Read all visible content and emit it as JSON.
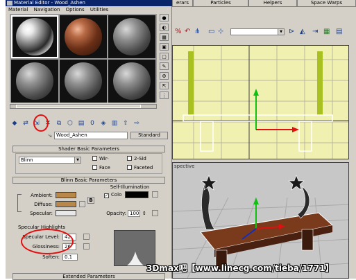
{
  "titlebar": {
    "title": "Material Editor - Wood_Ashen"
  },
  "menu": [
    "Material",
    "Navigation",
    "Options",
    "Utilities"
  ],
  "material_name": "Wood_Ashen",
  "material_type_button": "Standard",
  "shader_panel": {
    "header": "Shader Basic Parameters",
    "shader": "Blinn",
    "wire": "Wir·",
    "two_sided": "2-Sid",
    "face": "Face",
    "faceted": "Faceted"
  },
  "blinn_panel": {
    "header": "Blinn Basic Parameters",
    "self_illum_group": "Self-Illumination",
    "color_label": "Colo",
    "ambient": "Ambient:",
    "diffuse": "Diffuse:",
    "specular": "Specular:",
    "lock_label": "B",
    "opacity_label": "Opacity:",
    "opacity_value": "100",
    "opacity_suffix": "↕",
    "specular_highlights": {
      "group": "Specular Highlights",
      "specular_level_label": "Specular Level:",
      "specular_level_value": "42",
      "glossiness_label": "Glossiness:",
      "glossiness_value": "26",
      "soften_label": "Soften:",
      "soften_value": "0.1"
    }
  },
  "extended_header": "Extended Parameters",
  "viewport": {
    "tabs": [
      "erars",
      "Particles",
      "Helpers",
      "Space Warps"
    ],
    "persp_label": "spective"
  },
  "watermark": "3Dmax吧【www.linecg.com/tieba/1771】",
  "colors": {
    "ambient": "#b8874a",
    "diffuse": "#b8874a",
    "specular": "#e8e8e8",
    "self_illum": "#000000",
    "highlight_circle": "#e01010"
  }
}
